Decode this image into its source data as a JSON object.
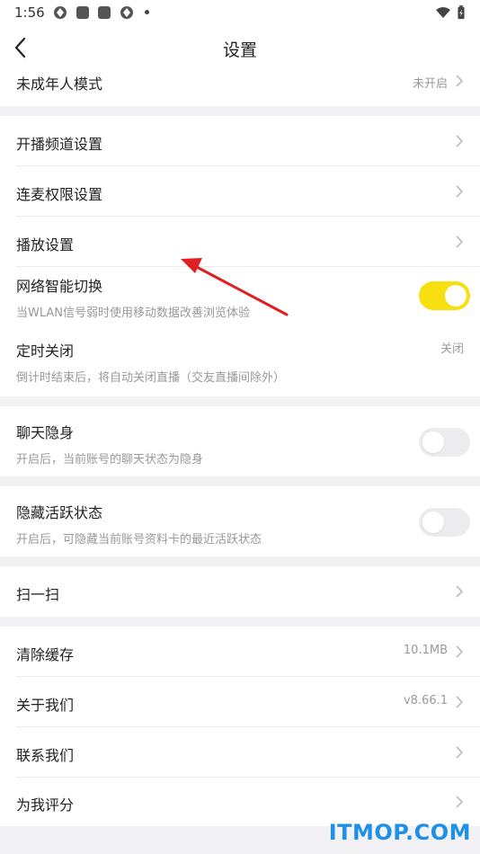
{
  "status_bar": {
    "time": "1:56"
  },
  "header": {
    "title": "设置"
  },
  "rows": {
    "minor_mode": {
      "label": "未成年人模式",
      "value": "未开启"
    },
    "channel_settings": {
      "label": "开播频道设置"
    },
    "mic_permission": {
      "label": "连麦权限设置"
    },
    "playback_settings": {
      "label": "播放设置"
    },
    "network_switch": {
      "label": "网络智能切换",
      "desc": "当WLAN信号弱时使用移动数据改善浏览体验",
      "enabled": true
    },
    "timer_off": {
      "label": "定时关闭",
      "desc": "倒计时结束后，将自动关闭直播（交友直播间除外）",
      "value": "关闭"
    },
    "chat_invisible": {
      "label": "聊天隐身",
      "desc": "开启后，当前账号的聊天状态为隐身",
      "enabled": false
    },
    "hide_active": {
      "label": "隐藏活跃状态",
      "desc": "开启后，可隐藏当前账号资料卡的最近活跃状态",
      "enabled": false
    },
    "scan": {
      "label": "扫一扫"
    },
    "clear_cache": {
      "label": "清除缓存",
      "value": "10.1MB"
    },
    "about": {
      "label": "关于我们",
      "value": "v8.66.1"
    },
    "contact": {
      "label": "联系我们"
    },
    "rate": {
      "label": "为我评分"
    }
  },
  "colors": {
    "toggle_on": "#f8df10",
    "annotation_arrow": "#e02020",
    "watermark": "#1e90e8"
  },
  "watermark": "ITMOP.COM"
}
